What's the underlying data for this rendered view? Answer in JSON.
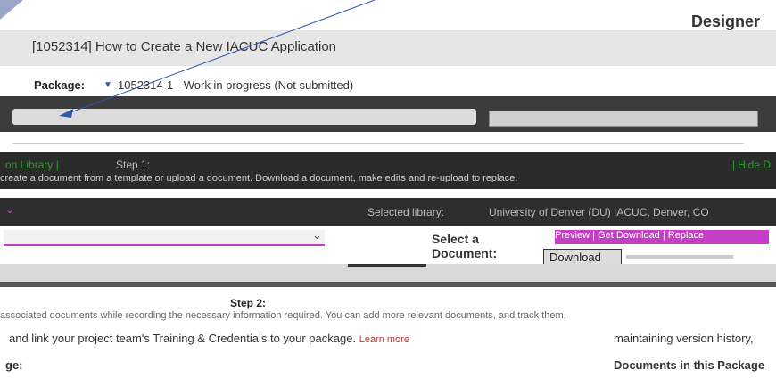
{
  "header": {
    "designer_label": "Designer",
    "title": "[1052314] How to Create a New IACUC Application"
  },
  "package": {
    "label": "Package:",
    "value": "1052314-1 - Work in progress (Not submitted)"
  },
  "step1": {
    "side_link": "on Library |",
    "label": "Step 1:",
    "hide_link": "| Hide D",
    "description": "create a document from a template or upload a document. Download a document, make edits and re-upload to replace."
  },
  "library": {
    "label": "Selected library:",
    "value": "University of Denver (DU) IACUC, Denver, CO"
  },
  "document": {
    "select_label": "Select a Document:",
    "links_text": "Preview | Get Download | Replace",
    "download_label": "Download"
  },
  "step2": {
    "label": "Step 2:",
    "description": "associated documents while recording the necessary information required. You can add more relevant documents, and track them,",
    "main_text": "and link your project team's Training & Credentials to your package.",
    "learn_more": "Learn more",
    "right_text": "maintaining version history,"
  },
  "footer": {
    "left_label": "ge:",
    "right_label": "Documents in this Package"
  },
  "colors": {
    "accent_magenta": "#c33fc3",
    "link_green": "#2f9a2f",
    "pointer_blue": "#2f5aa8",
    "learn_more_red": "#c0392b"
  }
}
